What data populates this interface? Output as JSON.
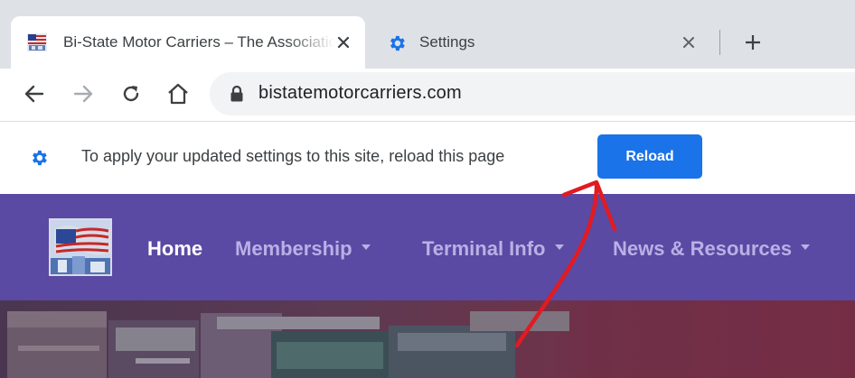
{
  "browser": {
    "tabs": [
      {
        "title": "Bi-State Motor Carriers – The Association",
        "active": true,
        "favicon": "flag-favicon-icon"
      },
      {
        "title": "Settings",
        "active": false,
        "favicon": "gear-icon"
      }
    ],
    "new_tab_icon": "plus-icon",
    "close_icon": "close-icon",
    "nav": [
      "back-icon",
      "forward-icon",
      "reload-icon",
      "home-icon"
    ],
    "address_bar": {
      "url": "bistatemotorcarriers.com",
      "icon": "lock-icon"
    }
  },
  "infobar": {
    "icon": "gear-icon",
    "message": "To apply your updated settings to this site, reload this page",
    "button_label": "Reload",
    "button_color": "#1a73e8"
  },
  "site": {
    "header_color": "#5a4aa3",
    "nav": [
      {
        "label": "Home",
        "active": true,
        "dropdown": false
      },
      {
        "label": "Membership",
        "active": false,
        "dropdown": true
      },
      {
        "label": "Terminal Info",
        "active": false,
        "dropdown": true
      },
      {
        "label": "News & Resources",
        "active": false,
        "dropdown": true
      }
    ],
    "hero": {
      "overlay_color": "#6b3550"
    }
  },
  "annotation": {
    "type": "arrow",
    "color": "#e11b22",
    "points_to": "reload-button"
  }
}
